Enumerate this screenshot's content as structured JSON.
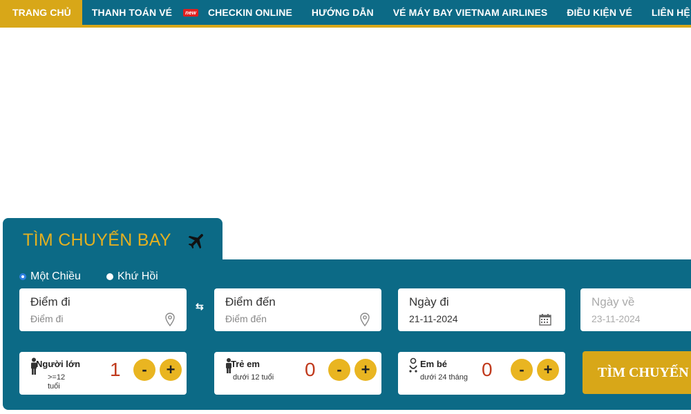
{
  "nav": {
    "items": [
      {
        "label": "TRANG CHỦ",
        "active": true
      },
      {
        "label": "THANH TOÁN VÉ"
      },
      {
        "label": "CHECKIN ONLINE",
        "badge": "new"
      },
      {
        "label": "HƯỚNG DẪN"
      },
      {
        "label": "VÉ MÁY BAY VIETNAM AIRLINES"
      },
      {
        "label": "ĐIỀU KIỆN VÉ"
      },
      {
        "label": "LIÊN HỆ"
      }
    ]
  },
  "search": {
    "title": "TÌM CHUYẾN BAY",
    "trip_one_way": "Một Chiều",
    "trip_round": "Khứ Hồi",
    "from": {
      "label": "Điểm đi",
      "placeholder": "Điểm đi"
    },
    "to": {
      "label": "Điểm đến",
      "placeholder": "Điểm đến"
    },
    "depart": {
      "label": "Ngày đi",
      "value": "21-11-2024"
    },
    "return": {
      "label": "Ngày về",
      "value": "23-11-2024"
    },
    "adult": {
      "label": "Người lớn",
      "sub1": ">=12",
      "sub2": "tuổi",
      "count": "1"
    },
    "child": {
      "label": "Trẻ em",
      "sub": "dưới 12 tuổi",
      "count": "0"
    },
    "infant": {
      "label": "Em bé",
      "sub": "dưới 24 tháng",
      "count": "0"
    },
    "minus": "-",
    "plus": "+",
    "button": "TÌM CHUYẾN BAY"
  },
  "colors": {
    "primary": "#0c6a86",
    "accent": "#d8a718",
    "count": "#c03a1d"
  }
}
